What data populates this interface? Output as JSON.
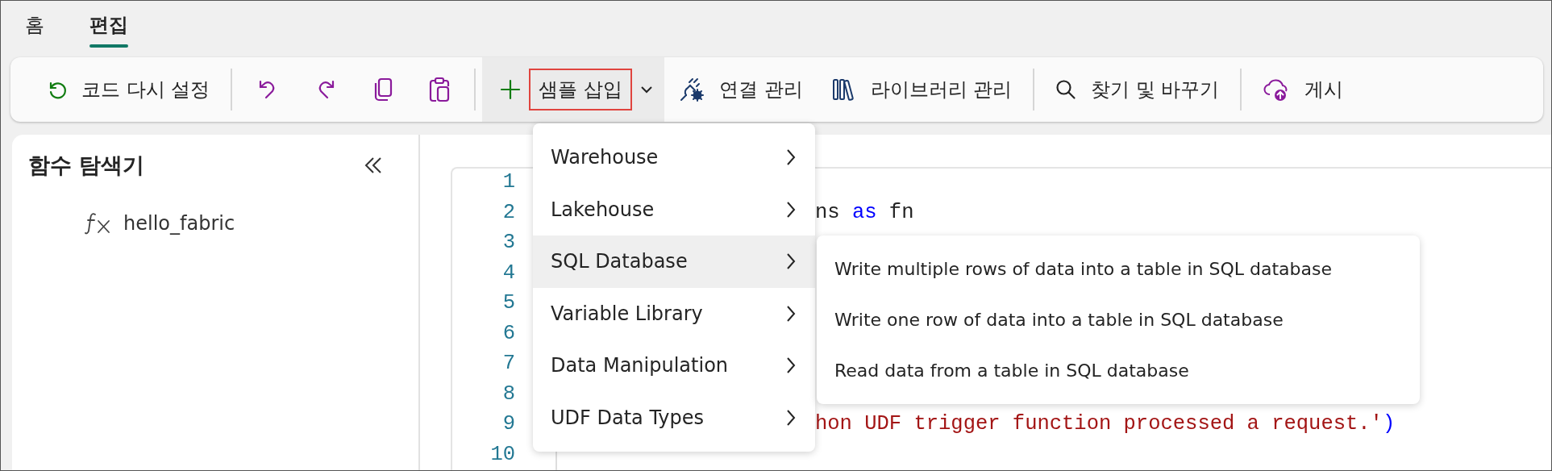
{
  "tabs": [
    {
      "label": "홈",
      "selected": false
    },
    {
      "label": "편집",
      "selected": true
    }
  ],
  "toolbar": {
    "items": [
      {
        "kind": "text",
        "label": "코드 다시 설정"
      },
      {
        "kind": "separator"
      },
      {
        "kind": "icon"
      },
      {
        "kind": "icon"
      },
      {
        "kind": "icon"
      },
      {
        "kind": "icon"
      },
      {
        "kind": "separator"
      },
      {
        "kind": "split",
        "label": "샘플 삽입",
        "expanded": true,
        "highlighted": true
      },
      {
        "kind": "text",
        "label": "연결 관리"
      },
      {
        "kind": "text",
        "label": "라이브러리 관리"
      },
      {
        "kind": "separator"
      },
      {
        "kind": "text",
        "label": "찾기 및 바꾸기"
      },
      {
        "kind": "separator"
      },
      {
        "kind": "text",
        "label": "게시"
      }
    ]
  },
  "explorer": {
    "title": "함수 탐색기",
    "items": [
      {
        "label": "hello_fabric"
      }
    ]
  },
  "editor": {
    "lines": [
      {
        "number": "1"
      },
      {
        "number": "2",
        "tokens": [
          {
            "text": "ns ",
            "kind": "plain"
          },
          {
            "text": "as",
            "kind": "keyword"
          },
          {
            "text": " fn",
            "kind": "plain"
          }
        ]
      },
      {
        "number": "3"
      },
      {
        "number": "4"
      },
      {
        "number": "5"
      },
      {
        "number": "6"
      },
      {
        "number": "7"
      },
      {
        "number": "8"
      },
      {
        "number": "9",
        "tokens": [
          {
            "text": "hon UDF trigger function processed a request.'",
            "kind": "string"
          },
          {
            "text": ")",
            "kind": "keyword"
          }
        ]
      },
      {
        "number": "10"
      }
    ]
  },
  "menu": {
    "items": [
      {
        "label": "Warehouse",
        "selected": false
      },
      {
        "label": "Lakehouse",
        "selected": false
      },
      {
        "label": "SQL Database",
        "selected": true
      },
      {
        "label": "Variable Library",
        "selected": false
      },
      {
        "label": "Data Manipulation",
        "selected": false
      },
      {
        "label": "UDF Data Types",
        "selected": false
      }
    ],
    "submenu": {
      "items": [
        {
          "label": "Write multiple rows of data into a table in SQL database"
        },
        {
          "label": "Write one row of data into a table in SQL database"
        },
        {
          "label": "Read data from a table in SQL database"
        }
      ]
    }
  }
}
